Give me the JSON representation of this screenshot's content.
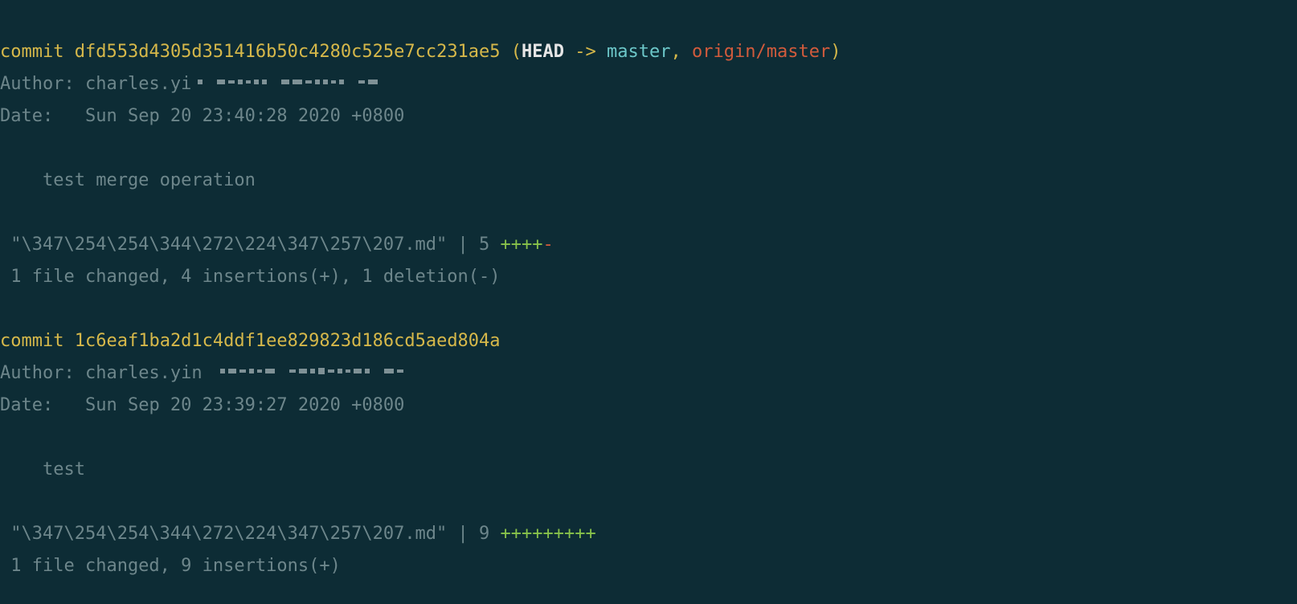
{
  "commits": [
    {
      "label_commit": "commit",
      "hash": "dfd553d4305d351416b50c4280c525e7cc231ae5",
      "refs_open": " (",
      "head": "HEAD",
      "arrow": " -> ",
      "local_branch": "master",
      "sep": ", ",
      "remote_branch": "origin/master",
      "refs_close": ")",
      "author_label": "Author: ",
      "author_name": "charles.yi",
      "date_label": "Date:   ",
      "date_value": "Sun Sep 20 23:40:28 2020 +0800",
      "message": "    test merge operation",
      "stat_file": " \"\\347\\254\\254\\344\\272\\224\\347\\257\\207.md\" | 5 ",
      "stat_plus": "++++",
      "stat_minus": "-",
      "summary": " 1 file changed, 4 insertions(+), 1 deletion(-)"
    },
    {
      "label_commit": "commit",
      "hash": "1c6eaf1ba2d1c4ddf1ee829823d186cd5aed804a",
      "author_label": "Author: ",
      "author_name": "charles.yin",
      "date_label": "Date:   ",
      "date_value": "Sun Sep 20 23:39:27 2020 +0800",
      "message": "    test",
      "stat_file": " \"\\347\\254\\254\\344\\272\\224\\347\\257\\207.md\" | 9 ",
      "stat_plus": "+++++++++",
      "stat_minus": "",
      "summary": " 1 file changed, 9 insertions(+)"
    }
  ]
}
